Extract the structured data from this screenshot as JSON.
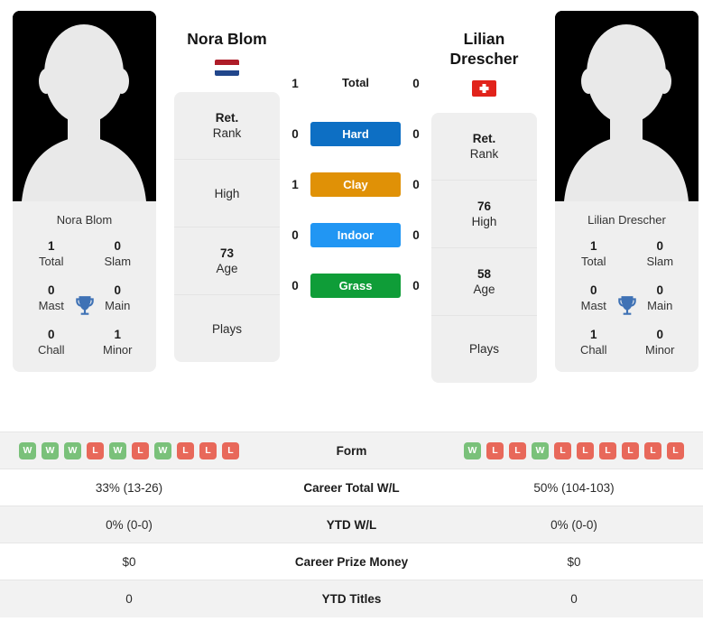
{
  "players": {
    "left": {
      "name": "Nora Blom",
      "photo_caption": "Nora Blom",
      "country": "netherlands",
      "flag_icon": "flag-netherlands-icon",
      "titles": [
        {
          "value": "1",
          "label": "Total"
        },
        {
          "value": "0",
          "label": "Slam"
        },
        {
          "value": "0",
          "label": "Mast"
        },
        {
          "value": "0",
          "label": "Main"
        },
        {
          "value": "0",
          "label": "Chall"
        },
        {
          "value": "1",
          "label": "Minor"
        }
      ],
      "info": [
        {
          "value": "Ret.",
          "label": "Rank"
        },
        {
          "value": "",
          "label": "High"
        },
        {
          "value": "73",
          "label": "Age"
        },
        {
          "value": "",
          "label": "Plays"
        }
      ],
      "form": [
        "W",
        "W",
        "W",
        "L",
        "W",
        "L",
        "W",
        "L",
        "L",
        "L"
      ]
    },
    "right": {
      "name": "Lilian Drescher",
      "photo_caption": "Lilian Drescher",
      "country": "switzerland",
      "flag_icon": "flag-switzerland-icon",
      "titles": [
        {
          "value": "1",
          "label": "Total"
        },
        {
          "value": "0",
          "label": "Slam"
        },
        {
          "value": "0",
          "label": "Mast"
        },
        {
          "value": "0",
          "label": "Main"
        },
        {
          "value": "1",
          "label": "Chall"
        },
        {
          "value": "0",
          "label": "Minor"
        }
      ],
      "info": [
        {
          "value": "Ret.",
          "label": "Rank"
        },
        {
          "value": "76",
          "label": "High"
        },
        {
          "value": "58",
          "label": "Age"
        },
        {
          "value": "",
          "label": "Plays"
        }
      ],
      "form": [
        "W",
        "L",
        "L",
        "W",
        "L",
        "L",
        "L",
        "L",
        "L",
        "L"
      ]
    }
  },
  "head_to_head": {
    "total": {
      "label": "Total",
      "left": "1",
      "right": "0"
    },
    "surfaces": [
      {
        "label": "Hard",
        "left": "0",
        "right": "0",
        "color": "#0d6fc4"
      },
      {
        "label": "Clay",
        "left": "1",
        "right": "0",
        "color": "#e09106"
      },
      {
        "label": "Indoor",
        "left": "0",
        "right": "0",
        "color": "#2196f3"
      },
      {
        "label": "Grass",
        "left": "0",
        "right": "0",
        "color": "#0f9d38"
      }
    ]
  },
  "comparison_rows": [
    {
      "label": "Form",
      "left": "",
      "right": "",
      "type": "form"
    },
    {
      "label": "Career Total W/L",
      "left": "33% (13-26)",
      "right": "50% (104-103)",
      "type": "text"
    },
    {
      "label": "YTD W/L",
      "left": "0% (0-0)",
      "right": "0% (0-0)",
      "type": "text"
    },
    {
      "label": "Career Prize Money",
      "left": "$0",
      "right": "$0",
      "type": "text"
    },
    {
      "label": "YTD Titles",
      "left": "0",
      "right": "0",
      "type": "text"
    }
  ],
  "icons": {
    "trophy": "trophy-icon",
    "avatar": "avatar-placeholder-icon"
  },
  "colors": {
    "win": "#7ac17a",
    "loss": "#e8685a",
    "card_bg": "#efefef",
    "row_alt": "#f2f2f2"
  }
}
